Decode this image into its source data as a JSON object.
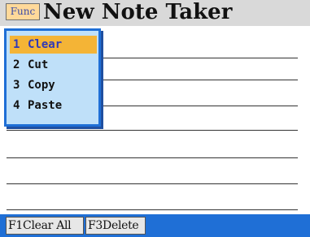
{
  "titlebar": {
    "func_label": "Func",
    "title": "New Note Taker"
  },
  "menu": {
    "items": [
      {
        "number": "1",
        "label": "Clear",
        "selected": true
      },
      {
        "number": "2",
        "label": "Cut",
        "selected": false
      },
      {
        "number": "3",
        "label": "Copy",
        "selected": false
      },
      {
        "number": "4",
        "label": "Paste",
        "selected": false
      }
    ]
  },
  "softkeys": {
    "f1": {
      "key": "F1",
      "label": "Clear All"
    },
    "f3": {
      "key": "F3",
      "label": "Delete"
    }
  },
  "colors": {
    "menu_border": "#1f6fd6",
    "menu_background": "#bfe0f9",
    "selection": "#f4b436",
    "bottom_bar": "#1f6fd6",
    "func_button": "#ffd99a"
  }
}
